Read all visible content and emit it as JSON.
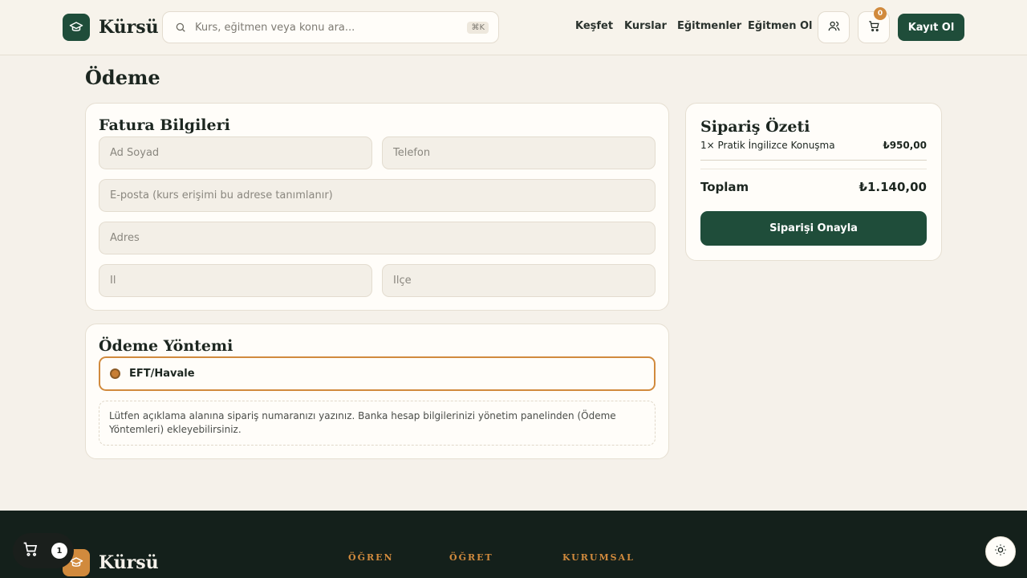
{
  "header": {
    "brand": "Kürsü",
    "search_placeholder": "Kurs, eğitmen veya konu ara...",
    "search_shortcut": "⌘K",
    "nav": [
      "Keşfet",
      "Kurslar",
      "Eğitmenler",
      "Eğitmen Ol"
    ],
    "cart_count": "0",
    "signup_label": "Kayıt Ol"
  },
  "page": {
    "title": "Ödeme"
  },
  "billing": {
    "title": "Fatura Bilgileri",
    "name_placeholder": "Ad Soyad",
    "phone_placeholder": "Telefon",
    "email_placeholder": "E-posta (kurs erişimi bu adrese tanımlanır)",
    "address_placeholder": "Adres",
    "city_placeholder": "İl",
    "district_placeholder": "İlçe"
  },
  "payment": {
    "title": "Ödeme Yöntemi",
    "selected_method": "EFT/Havale",
    "note": "Lütfen açıklama alanına sipariş numaranızı yazınız. Banka hesap bilgilerinizi yönetim panelinden (Ödeme Yöntemleri) ekleyebilirsiniz."
  },
  "summary": {
    "title": "Sipariş Özeti",
    "item_label": "1× Pratik İngilizce Konuşma",
    "item_price": "₺950,00",
    "total_label": "Toplam",
    "total_value": "₺1.140,00",
    "confirm_label": "Siparişi Onayla"
  },
  "footer": {
    "brand": "Kürsü",
    "columns": [
      "ÖĞREN",
      "ÖĞRET",
      "KURUMSAL"
    ]
  },
  "floating_cart": {
    "count": "1"
  },
  "colors": {
    "primary": "#1f4d3a",
    "accent": "#d18a3d",
    "background": "#f5f1ea"
  }
}
